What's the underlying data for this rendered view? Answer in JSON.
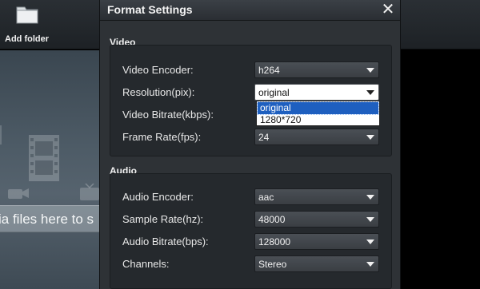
{
  "toolbar": {
    "add_folder_label": "Add folder"
  },
  "main": {
    "drop_text": "ia files here to s"
  },
  "dialog": {
    "title": "Format Settings",
    "close_symbol": "✕",
    "video": {
      "heading": "Video",
      "encoder": {
        "label": "Video Encoder:",
        "value": "h264"
      },
      "resolution": {
        "label": "Resolution(pix):",
        "value": "original",
        "options": [
          "original",
          "1280*720"
        ]
      },
      "bitrate": {
        "label": "Video Bitrate(kbps):"
      },
      "framerate": {
        "label": "Frame Rate(fps):",
        "value": "24"
      }
    },
    "audio": {
      "heading": "Audio",
      "encoder": {
        "label": "Audio Encoder:",
        "value": "aac"
      },
      "sample_rate": {
        "label": "Sample Rate(hz):",
        "value": "48000"
      },
      "bitrate": {
        "label": "Audio Bitrate(bps):",
        "value": "128000"
      },
      "channels": {
        "label": "Channels:",
        "value": "Stereo"
      }
    }
  },
  "icons": {
    "folder": "folder-icon",
    "close": "close-icon",
    "dropdown_arrow": "chevron-down-icon",
    "film": "film-icon",
    "camera": "camera-icon",
    "tv": "tv-icon"
  },
  "colors": {
    "dialog_bg": "#2e3236",
    "section_bg": "#25292d",
    "selection": "#1e5fbf",
    "background_gradient": "#4d5b66"
  }
}
